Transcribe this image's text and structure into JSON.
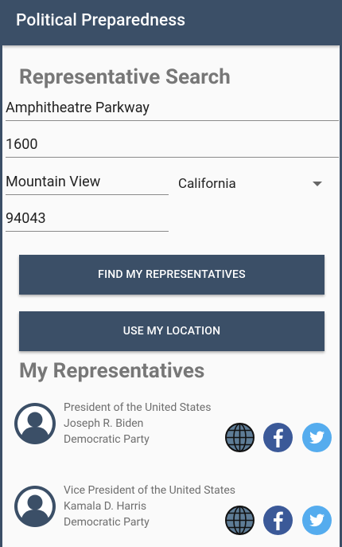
{
  "app": {
    "title": "Political Preparedness"
  },
  "search": {
    "heading": "Representative Search",
    "address_line1": "Amphitheatre Parkway",
    "address_line2": "1600",
    "city": "Mountain View",
    "state": "California",
    "zip": "94043",
    "find_button": "FIND MY REPRESENTATIVES",
    "location_button": "USE MY LOCATION"
  },
  "representatives": {
    "heading": "My Representatives",
    "items": [
      {
        "office": "President of the United States",
        "name": "Joseph R. Biden",
        "party": "Democratic Party"
      },
      {
        "office": "Vice President of the United States",
        "name": "Kamala D. Harris",
        "party": "Democratic Party"
      }
    ]
  },
  "colors": {
    "primary": "#3b4f67",
    "facebook": "#3b5998",
    "twitter": "#55acee",
    "globe": "#5e7c96"
  },
  "icons": [
    "avatar-icon",
    "globe-icon",
    "facebook-icon",
    "twitter-icon",
    "dropdown-caret-icon"
  ]
}
